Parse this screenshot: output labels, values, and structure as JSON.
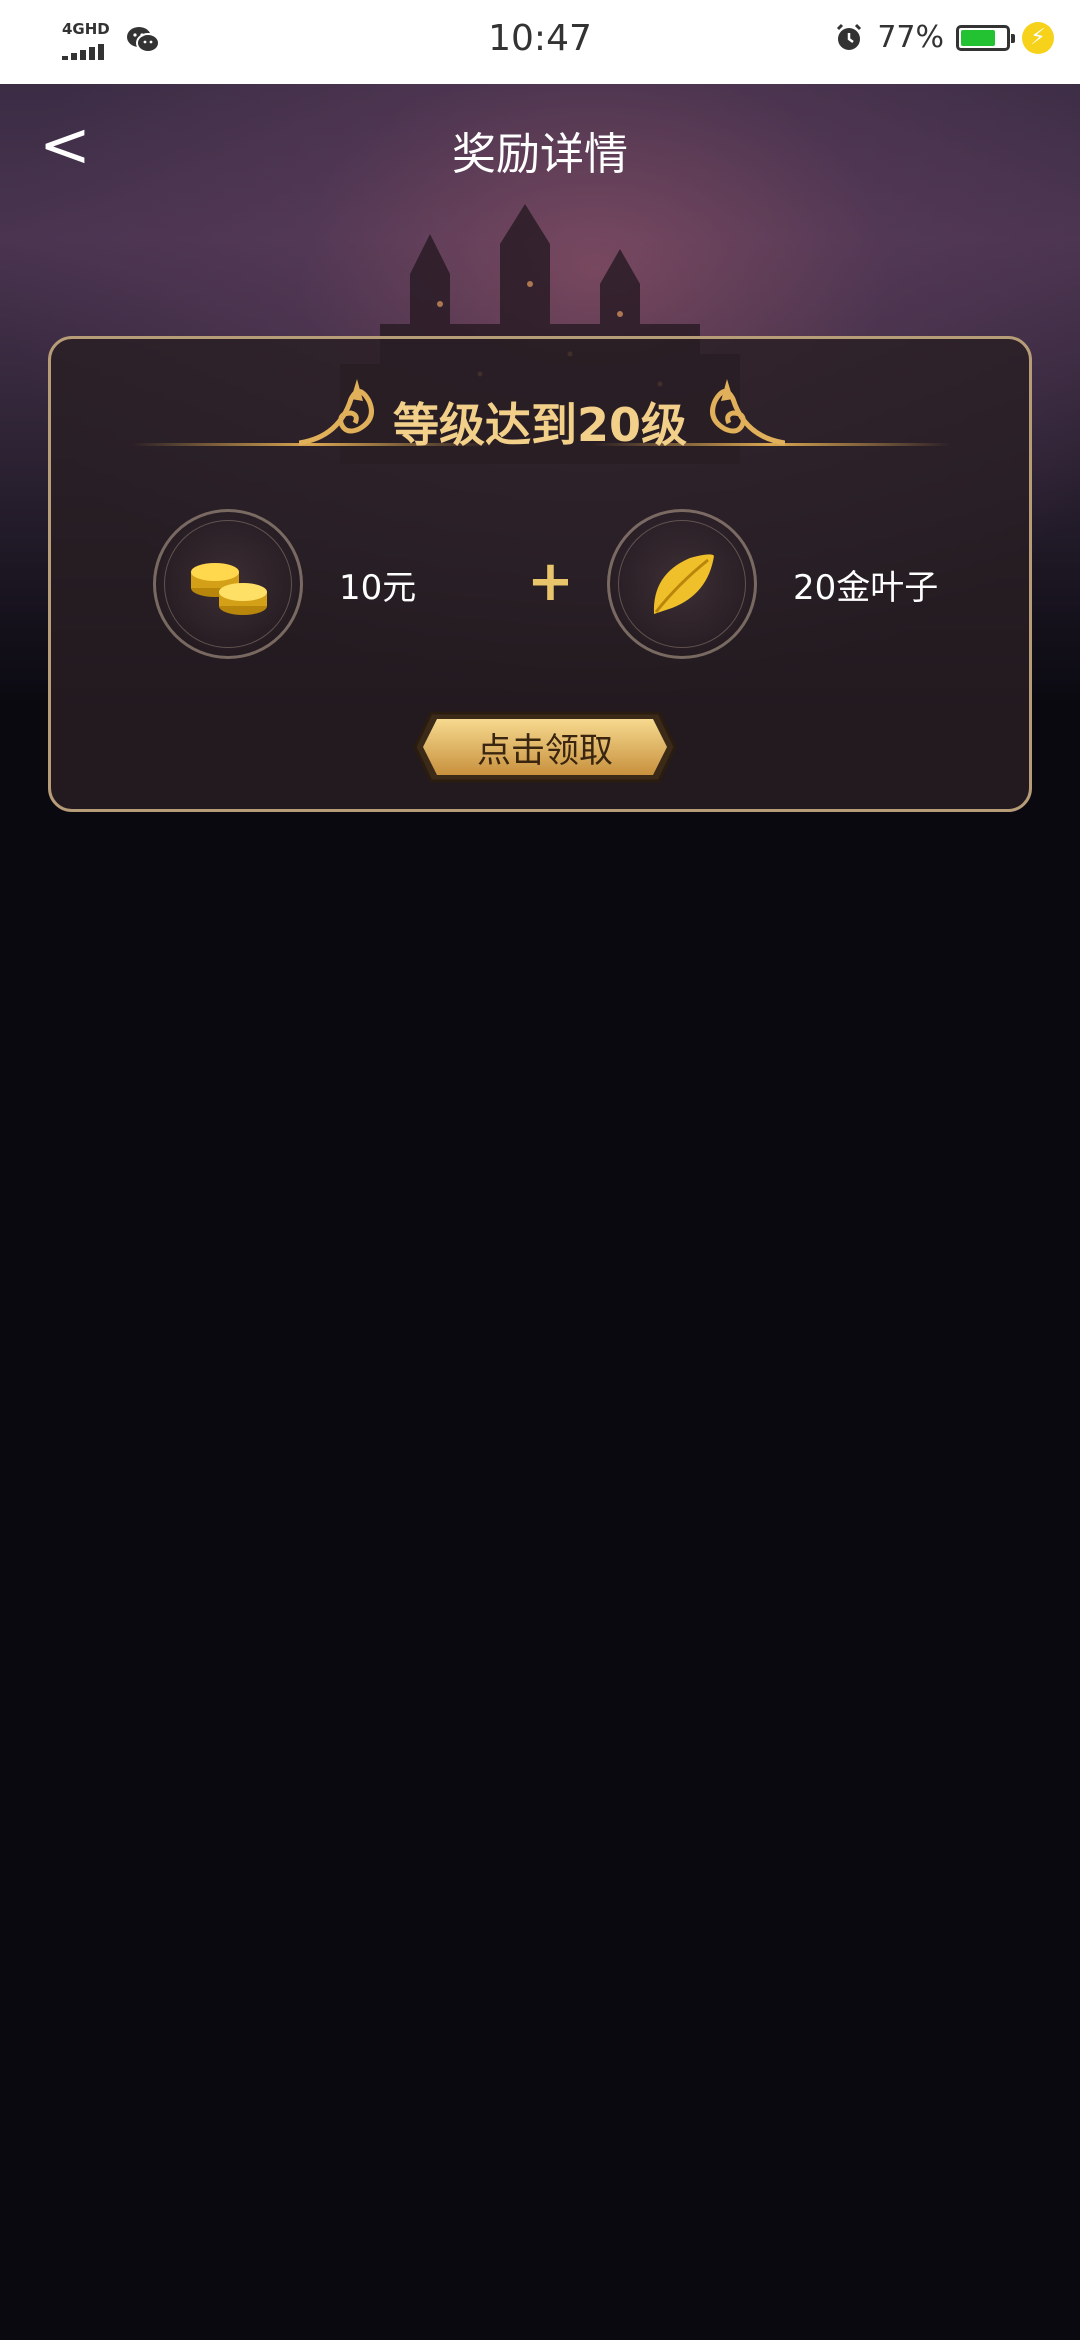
{
  "status_bar": {
    "network_label": "4GHD",
    "time": "10:47",
    "battery_percent_text": "77%",
    "battery_level": 0.77,
    "icons": [
      "signal-icon",
      "wechat-icon",
      "alarm-icon",
      "battery-icon",
      "charging-icon"
    ]
  },
  "header": {
    "back_label": "<",
    "title": "奖励详情"
  },
  "reward_card": {
    "title": "等级达到20级",
    "rewards": [
      {
        "icon": "gold-coins-icon",
        "label": "10元"
      },
      {
        "icon": "gold-leaf-icon",
        "label": "20金叶子"
      }
    ],
    "separator": "+",
    "claim_button_label": "点击领取"
  },
  "colors": {
    "accent_gold": "#f2d08a",
    "button_gold": "#d9a651",
    "card_border": "#b79c78",
    "background": "#0a0910",
    "battery_green": "#22c233"
  }
}
